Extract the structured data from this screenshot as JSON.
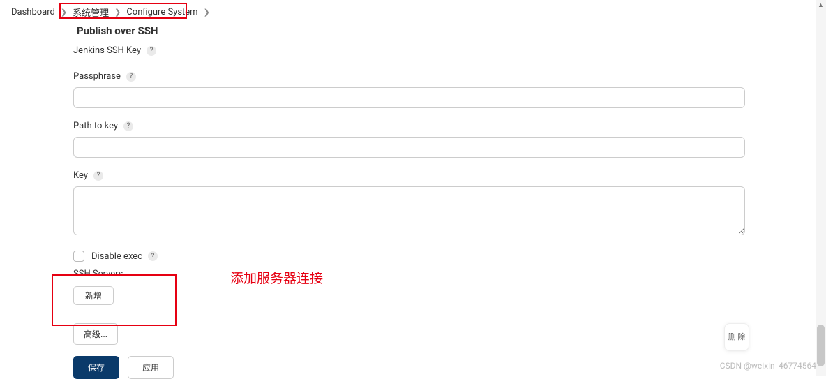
{
  "breadcrumb": {
    "dashboard": "Dashboard",
    "system_manage": "系统管理",
    "configure_system": "Configure System"
  },
  "title": "Publish over SSH",
  "jenkins_ssh_key": {
    "label": "Jenkins SSH Key"
  },
  "passphrase": {
    "label": "Passphrase",
    "value": ""
  },
  "path_to_key": {
    "label": "Path to key",
    "value": ""
  },
  "key": {
    "label": "Key",
    "value": ""
  },
  "disable_exec": {
    "label": "Disable exec",
    "checked": false
  },
  "ssh_servers": {
    "label": "SSH Servers"
  },
  "buttons": {
    "add": "新增",
    "advanced": "高级...",
    "save": "保存",
    "apply": "应用",
    "delete": "删\n除"
  },
  "annotation": "添加服务器连接",
  "watermark": "CSDN @weixin_46774564"
}
